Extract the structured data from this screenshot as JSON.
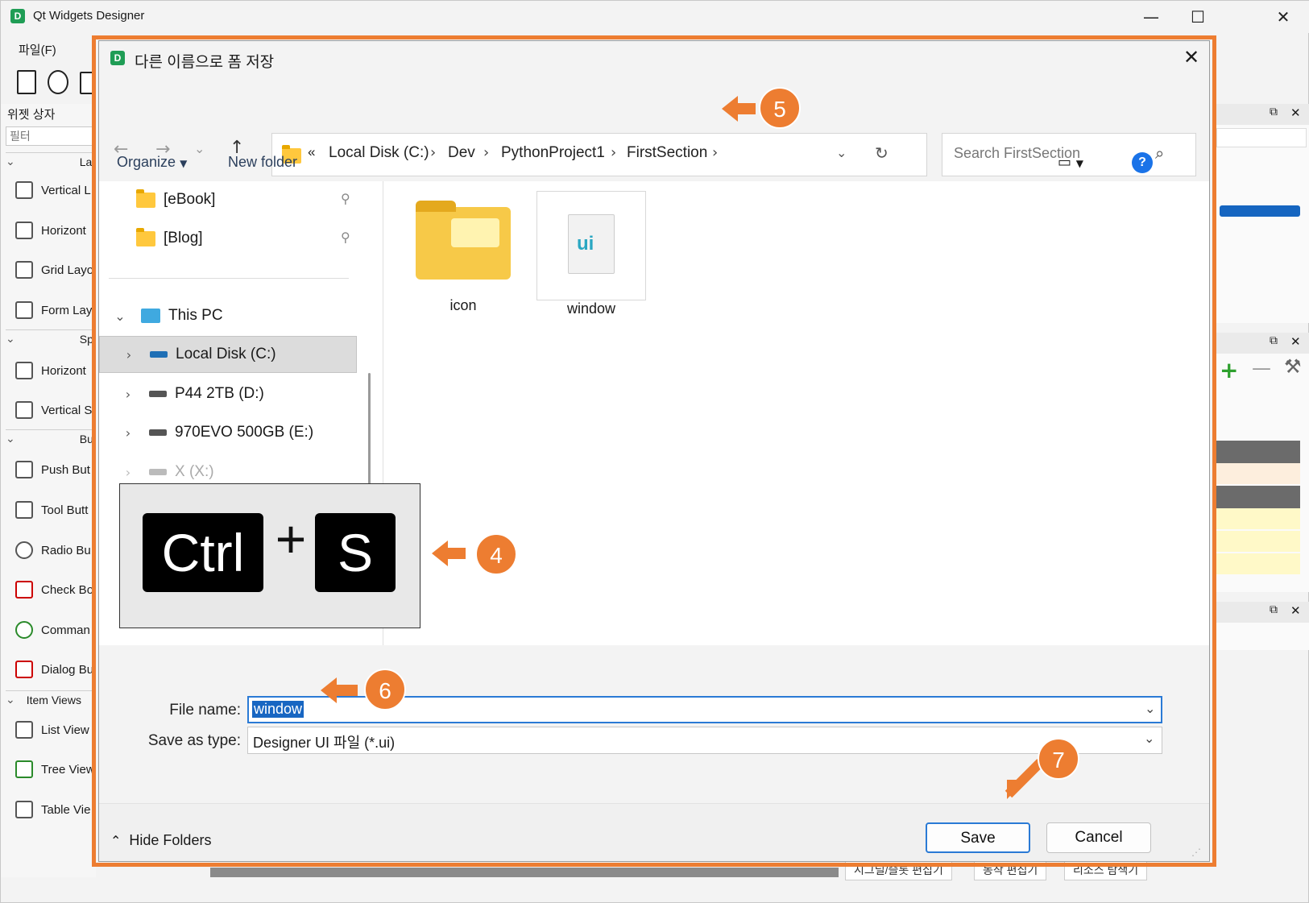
{
  "app": {
    "title": "Qt Widgets Designer",
    "menu_file": "파일(F)",
    "window_controls": [
      "—",
      "☐",
      "✕"
    ]
  },
  "widget_box": {
    "title": "위젯 상자",
    "filter_placeholder": "필터",
    "categories": [
      "La",
      "Sp",
      "Bu",
      "Item Views"
    ],
    "items": [
      {
        "label": "Vertical L",
        "icon": "vertical-layout-icon"
      },
      {
        "label": "Horizont",
        "icon": "horizontal-layout-icon"
      },
      {
        "label": "Grid Layo",
        "icon": "grid-layout-icon"
      },
      {
        "label": "Form Lay",
        "icon": "form-layout-icon"
      },
      {
        "label": "Horizont",
        "icon": "horizontal-spacer-icon"
      },
      {
        "label": "Vertical S",
        "icon": "vertical-spacer-icon"
      },
      {
        "label": "Push But",
        "icon": "push-button-icon"
      },
      {
        "label": "Tool Butt",
        "icon": "tool-button-icon"
      },
      {
        "label": "Radio Bu",
        "icon": "radio-button-icon"
      },
      {
        "label": "Check Bo",
        "icon": "check-box-icon"
      },
      {
        "label": "Comman",
        "icon": "command-link-icon"
      },
      {
        "label": "Dialog Bu",
        "icon": "dialog-button-icon"
      },
      {
        "label": "List View",
        "icon": "list-view-icon"
      },
      {
        "label": "Tree View",
        "icon": "tree-view-icon"
      },
      {
        "label": "Table Vie",
        "icon": "table-view-icon"
      }
    ]
  },
  "bottom_tabs": [
    "시그널/슬롯 편집기",
    "동작 편집기",
    "리소스 탐색기"
  ],
  "dialog": {
    "title": "다른 이름으로 폼 저장",
    "close": "✕",
    "breadcrumb_overflow": "«",
    "breadcrumbs": [
      "Local Disk (C:)",
      "Dev",
      "PythonProject1",
      "FirstSection"
    ],
    "search_placeholder": "Search FirstSection",
    "organize": "Organize",
    "new_folder": "New folder",
    "help": "?",
    "nav_items": {
      "quick": [
        {
          "label": "[eBook]"
        },
        {
          "label": "[Blog]"
        }
      ],
      "this_pc": "This PC",
      "drives": [
        {
          "label": "Local Disk (C:)"
        },
        {
          "label": "P44 2TB (D:)"
        },
        {
          "label": "970EVO 500GB (E:)"
        },
        {
          "label": "X (X:)"
        }
      ]
    },
    "files": [
      {
        "name": "icon",
        "type": "folder"
      },
      {
        "name": "window",
        "type": "ui-file",
        "icon_text": "ui"
      }
    ],
    "file_name_label": "File name:",
    "file_name_value": "window",
    "save_type_label": "Save as type:",
    "save_type_value": "Designer UI 파일 (*.ui)",
    "hide_folders": "Hide Folders",
    "save_button": "Save",
    "cancel_button": "Cancel"
  },
  "annotations": {
    "step4": "4",
    "step5": "5",
    "step6": "6",
    "step7": "7",
    "shortcut_key1": "Ctrl",
    "shortcut_plus": "+",
    "shortcut_key2": "S",
    "accent_color": "#ed7d31"
  }
}
